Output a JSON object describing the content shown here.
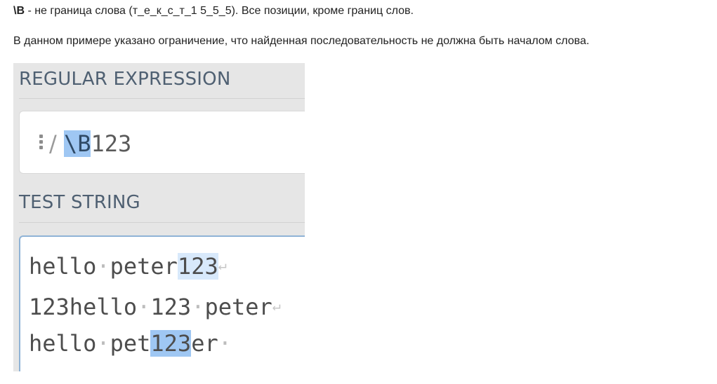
{
  "text": {
    "line1_bold": "\\B",
    "line1_rest": " - не граница слова (т_е_к_с_т_1 5_5_5). Все позиции, кроме границ слов.",
    "line2": "В данном примере указано ограничение, что найденная последовательность не должна быть началом слова."
  },
  "regex_panel": {
    "title": "REGULAR EXPRESSION",
    "slash": "/ ",
    "pattern_highlight": "\\B",
    "pattern_rest": "123"
  },
  "test_panel": {
    "title": "TEST STRING",
    "lines": [
      {
        "segments": [
          {
            "text": "hello",
            "style": "plain"
          },
          {
            "text": "·",
            "style": "dot"
          },
          {
            "text": "peter",
            "style": "plain"
          },
          {
            "text": "123",
            "style": "match-light"
          },
          {
            "text": "↵",
            "style": "return"
          }
        ]
      },
      {
        "segments": [
          {
            "text": "123hello",
            "style": "plain"
          },
          {
            "text": "·",
            "style": "dot"
          },
          {
            "text": "123",
            "style": "plain"
          },
          {
            "text": "·",
            "style": "dot"
          },
          {
            "text": "peter",
            "style": "plain"
          },
          {
            "text": "↵",
            "style": "return"
          }
        ]
      },
      {
        "segments": [
          {
            "text": "hello",
            "style": "plain"
          },
          {
            "text": "·",
            "style": "dot"
          },
          {
            "text": "pet",
            "style": "plain"
          },
          {
            "text": "123",
            "style": "match-strong"
          },
          {
            "text": "er",
            "style": "plain"
          },
          {
            "text": "·",
            "style": "dot"
          }
        ]
      }
    ]
  },
  "icons": {
    "flags": "vertical-dots-menu-icon"
  },
  "colors": {
    "title": "#4f6072",
    "match_light": "#d8e9fb",
    "match_strong": "#9fc7f3",
    "test_border": "#8fb3d6"
  }
}
